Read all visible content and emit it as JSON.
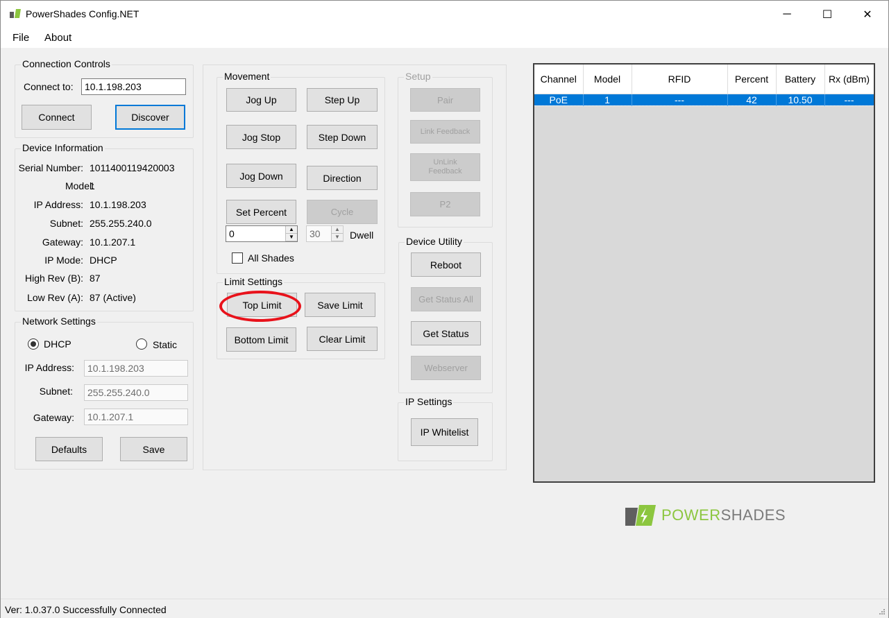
{
  "window": {
    "title": "PowerShades Config.NET",
    "controls": {
      "minimize": "─",
      "maximize": "☐",
      "close": "✕"
    }
  },
  "menu": {
    "file": "File",
    "about": "About"
  },
  "connection": {
    "legend": "Connection Controls",
    "connect_to_label": "Connect to:",
    "connect_to_value": "10.1.198.203",
    "connect_button": "Connect",
    "discover_button": "Discover"
  },
  "device_info": {
    "legend": "Device Information",
    "rows": [
      {
        "label": "Serial Number:",
        "value": "1011400119420003"
      },
      {
        "label": "Model:",
        "value": "1"
      },
      {
        "label": "IP Address:",
        "value": "10.1.198.203"
      },
      {
        "label": "Subnet:",
        "value": "255.255.240.0"
      },
      {
        "label": "Gateway:",
        "value": "10.1.207.1"
      },
      {
        "label": "IP Mode:",
        "value": "DHCP"
      },
      {
        "label": "High Rev (B):",
        "value": "87"
      },
      {
        "label": "Low Rev (A):",
        "value": "87 (Active)"
      }
    ]
  },
  "network": {
    "legend": "Network Settings",
    "dhcp_label": "DHCP",
    "static_label": "Static",
    "selected_mode": "DHCP",
    "ip_label": "IP Address:",
    "ip_value": "10.1.198.203",
    "subnet_label": "Subnet:",
    "subnet_value": "255.255.240.0",
    "gateway_label": "Gateway:",
    "gateway_value": "10.1.207.1",
    "defaults_button": "Defaults",
    "save_button": "Save"
  },
  "movement": {
    "legend": "Movement",
    "jog_up": "Jog Up",
    "step_up": "Step Up",
    "jog_stop": "Jog Stop",
    "step_down": "Step Down",
    "jog_down": "Jog Down",
    "direction": "Direction",
    "set_percent": "Set Percent",
    "cycle": "Cycle",
    "percent_value": "0",
    "dwell_value": "30",
    "dwell_label": "Dwell",
    "all_shades_label": "All Shades"
  },
  "limits": {
    "legend": "Limit Settings",
    "top_limit": "Top Limit",
    "save_limit": "Save Limit",
    "bottom_limit": "Bottom Limit",
    "clear_limit": "Clear Limit"
  },
  "setup": {
    "legend": "Setup",
    "pair": "Pair",
    "link_feedback": "Link Feedback",
    "unlink_feedback_1": "UnLink",
    "unlink_feedback_2": "Feedback",
    "p2": "P2"
  },
  "device_utility": {
    "legend": "Device Utility",
    "reboot": "Reboot",
    "get_status_all": "Get Status All",
    "get_status": "Get Status",
    "webserver": "Webserver"
  },
  "ip_settings": {
    "legend": "IP Settings",
    "ip_whitelist": "IP Whitelist"
  },
  "grid": {
    "columns": [
      "Channel",
      "Model",
      "RFID",
      "Percent",
      "Battery",
      "Rx (dBm)"
    ],
    "rows": [
      [
        "PoE",
        "1",
        "---",
        "42",
        "10.50",
        "---"
      ]
    ]
  },
  "logo": {
    "power": "POWER",
    "shades": "SHADES"
  },
  "status": {
    "text": "Ver: 1.0.37.0  Successfully Connected"
  },
  "colors": {
    "accent": "#0078d7",
    "highlight": "#e8121b",
    "brand_green": "#8cc63f"
  }
}
